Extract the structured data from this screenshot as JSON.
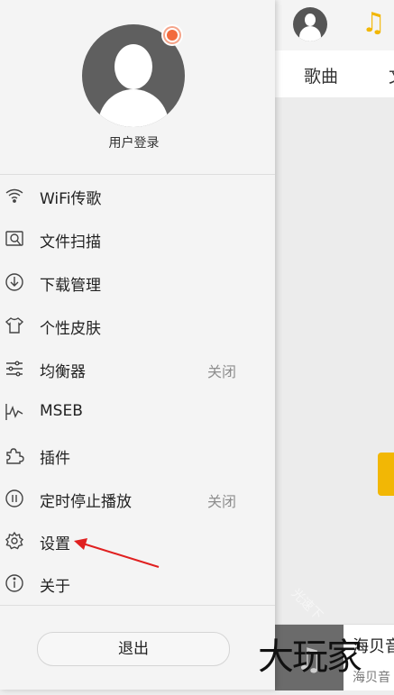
{
  "drawer": {
    "login_label": "用户登录",
    "menu": [
      {
        "label": "WiFi传歌",
        "icon": "wifi-icon",
        "status": ""
      },
      {
        "label": "文件扫描",
        "icon": "scan-icon",
        "status": ""
      },
      {
        "label": "下载管理",
        "icon": "download-icon",
        "status": ""
      },
      {
        "label": "个性皮肤",
        "icon": "shirt-icon",
        "status": ""
      },
      {
        "label": "均衡器",
        "icon": "equalizer-icon",
        "status": "关闭"
      },
      {
        "label": "MSEB",
        "icon": "waveform-icon",
        "status": ""
      },
      {
        "label": "插件",
        "icon": "puzzle-icon",
        "status": ""
      },
      {
        "label": "定时停止播放",
        "icon": "timer-icon",
        "status": "关闭"
      },
      {
        "label": "设置",
        "icon": "gear-icon",
        "status": ""
      },
      {
        "label": "关于",
        "icon": "info-icon",
        "status": ""
      }
    ],
    "exit_label": "退出"
  },
  "main": {
    "tab_songs": "歌曲",
    "tab_partial": "文",
    "player_title": "海贝音",
    "player_subtitle": "海贝音"
  },
  "overlay": {
    "watermark_text": "大玩家",
    "faint_watermark": "光速下"
  },
  "colors": {
    "accent": "#f2b705",
    "arrow": "#e02020",
    "drawer_bg": "#f4f4f4"
  }
}
